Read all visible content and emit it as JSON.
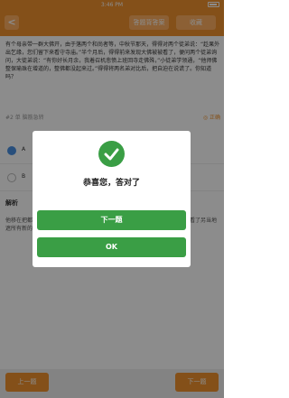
{
  "status_bar": {
    "carrier": "",
    "time": "3:46 PM"
  },
  "header": {
    "back_symbol": "<",
    "answer_button": "答题背答案",
    "favorite_button": "收藏"
  },
  "question": {
    "text": "有个母亲带一群大佛开，由于落两个和尚者等，中秋节那天，得得对两个徒弟说：“趁果外出乞缘，您们留下来看守寺庙。”半个月后，得得前来发现大佛被被看了，便问两个徒弟询问，大徒弟说：“有你好长月余，我着召机悲愤上班回寺走佛殊，”小徒弟学领通，“他师佛整保瑜珠在增道的，整佛都没起来过。”得得将两名弟对比后，把自迫在说谎了。你知道吗？"
  },
  "tags": {
    "qtype": "#2 单 脑筋急转",
    "correct_text": "◎ 正确"
  },
  "options": [
    {
      "label": "A",
      "selected": true
    },
    {
      "label": "B",
      "selected": false
    }
  ],
  "explanation": {
    "title": "解析",
    "body": "他移在把都将在起，有时，如同上来弹时，佛像都被找到了，没有说谎，我就看了另当地遮所有新的遮后，"
  },
  "bottom": {
    "prev_label": "上一题",
    "next_label": "下一题"
  },
  "dialog": {
    "message": "恭喜您，答对了",
    "next_button": "下一题",
    "ok_button": "OK"
  }
}
